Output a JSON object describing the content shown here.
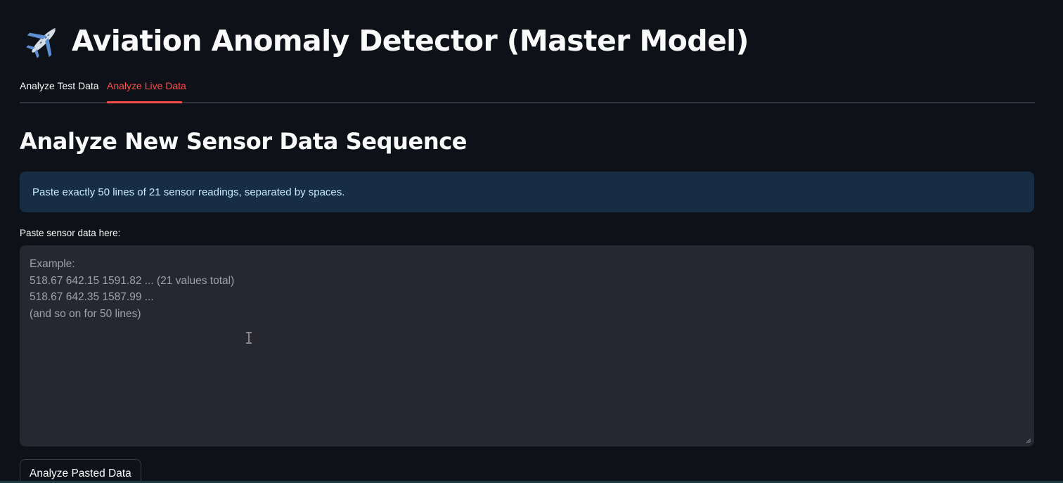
{
  "header": {
    "title": "Aviation Anomaly Detector (Master Model)",
    "icon": "airplane-icon"
  },
  "tabs": [
    {
      "label": "Analyze Test Data",
      "active": false
    },
    {
      "label": "Analyze Live Data",
      "active": true
    }
  ],
  "main": {
    "heading": "Analyze New Sensor Data Sequence",
    "info": "Paste exactly 50 lines of 21 sensor readings, separated by spaces.",
    "field_label": "Paste sensor data here:",
    "textarea_value": "",
    "textarea_placeholder": "Example:\n518.67 642.15 1591.82 ... (21 values total)\n518.67 642.35 1587.99 ...\n(and so on for 50 lines)",
    "submit_label": "Analyze Pasted Data"
  },
  "colors": {
    "background": "#0e1117",
    "accent": "#ff4b4b",
    "info_bg": "#172d43",
    "info_text": "#c7ebff",
    "input_bg": "#262730"
  }
}
